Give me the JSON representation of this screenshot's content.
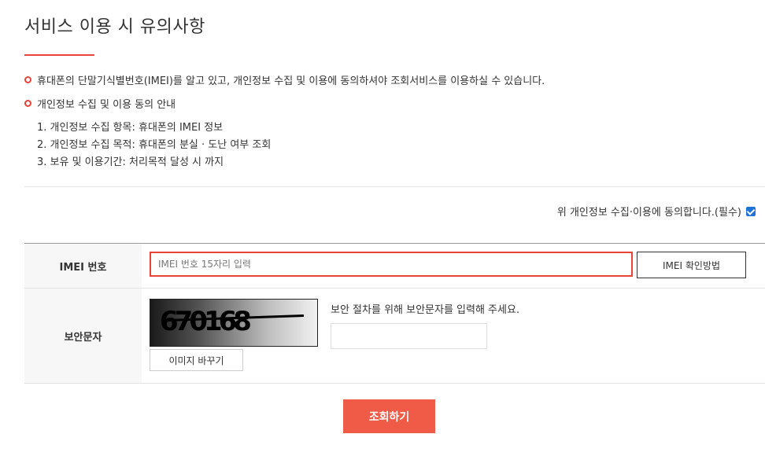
{
  "page": {
    "title": "서비스 이용 시 유의사항"
  },
  "notice": {
    "line1": "휴대폰의 단말기식별번호(IMEI)를 알고 있고, 개인정보 수집 및 이용에 동의하셔야 조회서비스를 이용하실 수 있습니다.",
    "line2": "개인정보 수집 및 이용 동의 안내",
    "items": [
      "1. 개인정보 수집 항목: 휴대폰의 IMEI 정보",
      "2. 개인정보 수집 목적: 휴대폰의 분실 · 도난 여부 조회",
      "3. 보유 및 이용기간: 처리목적 달성 시 까지"
    ]
  },
  "agree": {
    "label": "위 개인정보 수집·이용에 동의합니다.(필수)",
    "checked": true
  },
  "form": {
    "imei_label": "IMEI 번호",
    "imei_value": "",
    "imei_placeholder": "IMEI 번호 15자리 입력",
    "imei_help_button": "IMEI 확인방법",
    "security_label": "보안문자",
    "captcha_text": "670168",
    "refresh_button": "이미지 바꾸기",
    "security_guide": "보안 절차를 위해 보안문자를 입력해 주세요.",
    "security_value": ""
  },
  "submit_label": "조회하기",
  "colors": {
    "accent": "#e8443a",
    "submit_bg": "#ef5b46",
    "checkbox": "#1f72d8"
  }
}
